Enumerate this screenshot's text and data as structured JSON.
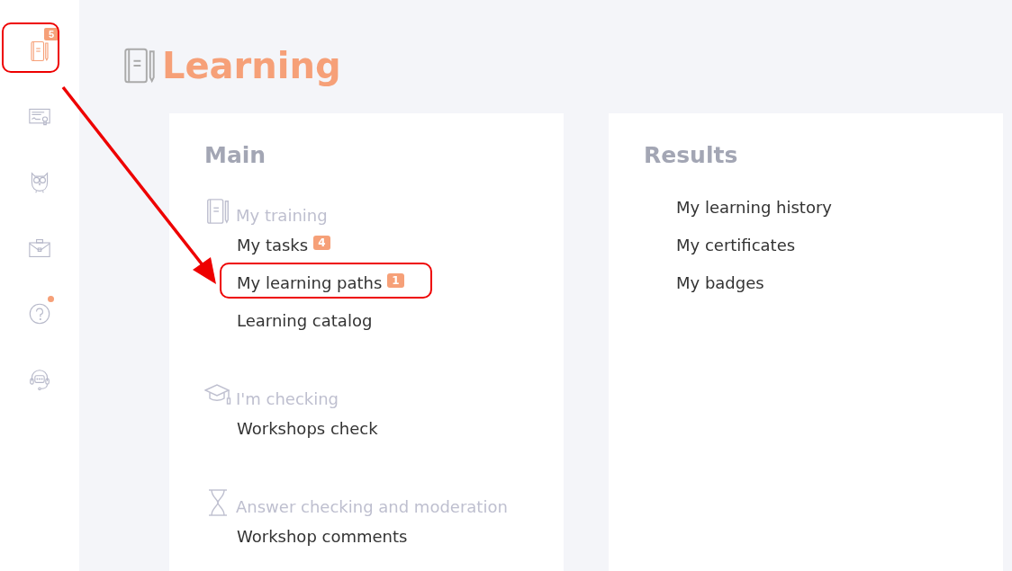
{
  "sidebar": {
    "items": [
      {
        "kind": "notebook",
        "selected": true,
        "badge": "5",
        "dot": false,
        "annotated": true
      },
      {
        "kind": "certificate",
        "selected": false,
        "dot": false,
        "annotated": false
      },
      {
        "kind": "owl",
        "selected": false,
        "dot": false,
        "annotated": false
      },
      {
        "kind": "briefcase",
        "selected": false,
        "dot": false,
        "annotated": false
      },
      {
        "kind": "help",
        "selected": false,
        "dot": true,
        "annotated": false
      },
      {
        "kind": "support",
        "selected": false,
        "dot": false,
        "annotated": false
      }
    ]
  },
  "page": {
    "title": "Learning"
  },
  "cards": [
    {
      "title": "Main",
      "sections": [
        {
          "kind": "notebook",
          "heading": "My training",
          "links": [
            {
              "label": "My tasks",
              "badge": "4",
              "annotated": false
            },
            {
              "label": "My learning paths",
              "badge": "1",
              "annotated": true
            },
            {
              "label": "Learning catalog",
              "annotated": false
            }
          ]
        },
        {
          "kind": "cap",
          "heading": "I'm checking",
          "links": [
            {
              "label": "Workshops check",
              "annotated": false
            }
          ]
        },
        {
          "kind": "hourglass",
          "heading": "Answer checking and moderation",
          "links": [
            {
              "label": "Workshop comments",
              "annotated": false
            }
          ]
        }
      ]
    },
    {
      "title": "Results",
      "sections": [
        {
          "links": [
            {
              "label": "My learning history",
              "annotated": false
            },
            {
              "label": "My certificates",
              "annotated": false
            },
            {
              "label": "My badges",
              "annotated": false
            }
          ]
        }
      ]
    }
  ],
  "annotation": {
    "arrow": true
  }
}
